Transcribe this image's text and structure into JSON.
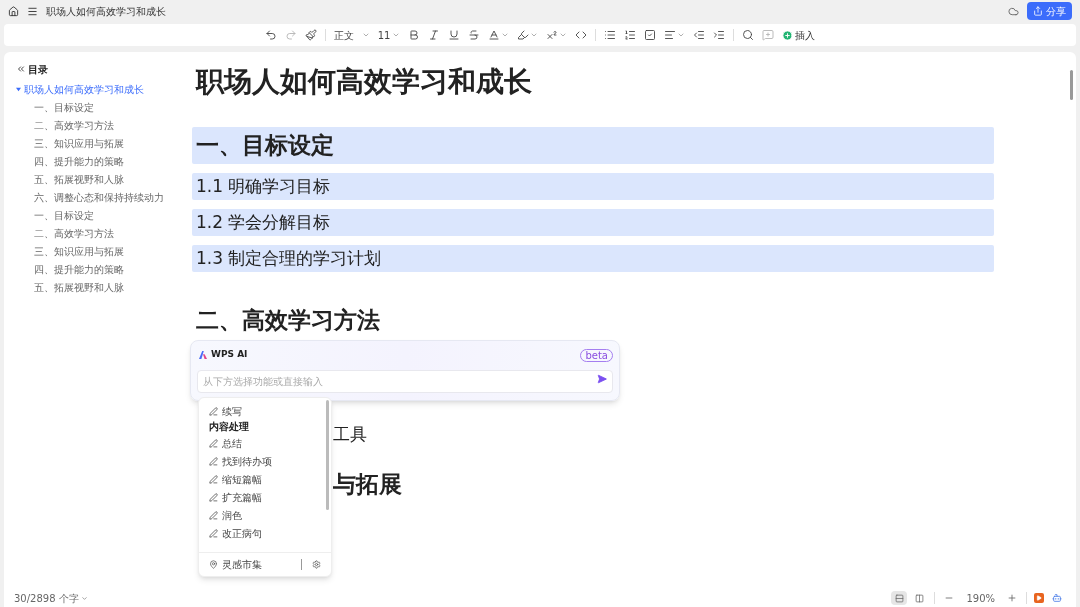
{
  "title_bar": {
    "title": "职场人如何高效学习和成长",
    "share_button": "分享"
  },
  "toolbar": {
    "paragraph_style": "正文",
    "font_size": "11",
    "insert_button": "插入"
  },
  "outline": {
    "header": "目录",
    "root": {
      "label": "职场人如何高效学习和成长",
      "expanded": true,
      "selected": true,
      "children": [
        {
          "label": "一、目标设定",
          "selected": false
        },
        {
          "label": "二、高效学习方法",
          "selected": false
        },
        {
          "label": "三、知识应用与拓展",
          "selected": false
        },
        {
          "label": "四、提升能力的策略",
          "selected": false
        },
        {
          "label": "五、拓展视野和人脉",
          "selected": false
        },
        {
          "label": "六、调整心态和保持持续动力",
          "selected": false
        },
        {
          "label": "一、目标设定",
          "selected": false
        },
        {
          "label": "二、高效学习方法",
          "selected": false
        },
        {
          "label": "三、知识应用与拓展",
          "selected": false
        },
        {
          "label": "四、提升能力的策略",
          "selected": false
        },
        {
          "label": "五、拓展视野和人脉",
          "selected": false
        }
      ]
    }
  },
  "document": {
    "title": "职场人如何高效学习和成长",
    "blocks": [
      {
        "kind": "h1",
        "text": "一、目标设定",
        "highlighted": true,
        "covered": false
      },
      {
        "kind": "h2",
        "text": "1.1 明确学习目标",
        "highlighted": true,
        "covered": false
      },
      {
        "kind": "h2",
        "text": "1.2 学会分解目标",
        "highlighted": true,
        "covered": false
      },
      {
        "kind": "h2",
        "text": "1.3 制定合理的学习计划",
        "highlighted": true,
        "covered": false
      },
      {
        "kind": "h1",
        "text": "二、高效学习方法",
        "highlighted": false,
        "covered": false
      },
      {
        "kind": "h2",
        "text": "工具",
        "highlighted": false,
        "covered": true
      },
      {
        "kind": "h1",
        "text": "与拓展",
        "highlighted": false,
        "covered": true
      }
    ]
  },
  "ai_panel": {
    "title": "WPS AI",
    "badge": "beta",
    "input": {
      "placeholder": "从下方选择功能或直接输入"
    },
    "menu": [
      {
        "kind": "item",
        "label": "续写"
      },
      {
        "kind": "section",
        "label": "内容处理"
      },
      {
        "kind": "item",
        "label": "总结"
      },
      {
        "kind": "item",
        "label": "找到待办项"
      },
      {
        "kind": "item",
        "label": "缩短篇幅"
      },
      {
        "kind": "item",
        "label": "扩充篇幅"
      },
      {
        "kind": "item",
        "label": "润色"
      },
      {
        "kind": "item",
        "label": "改正病句"
      }
    ],
    "footer_link": "灵感市集"
  },
  "status_bar": {
    "word_count": "30/2898 个字",
    "zoom": "190%",
    "layout_modes": [
      {
        "selected": true
      },
      {
        "selected": false
      }
    ]
  }
}
